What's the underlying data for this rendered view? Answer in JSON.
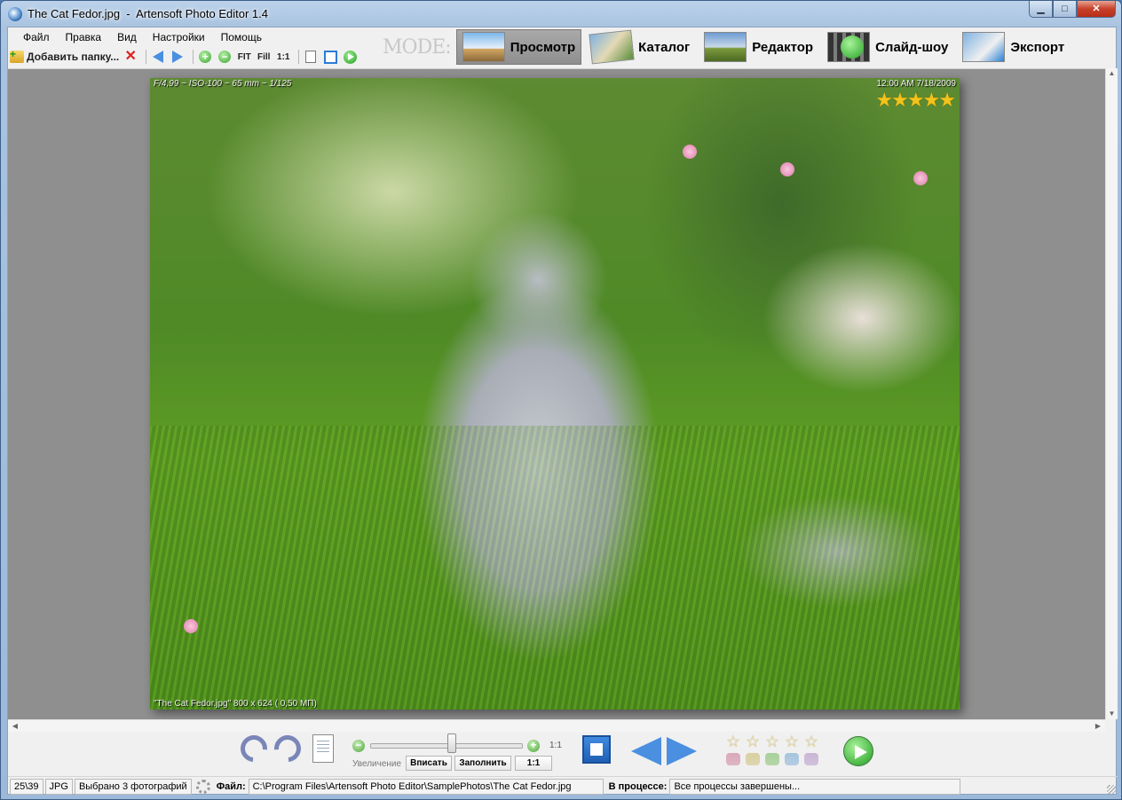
{
  "window": {
    "file_name": "The Cat Fedor.jpg",
    "app_name": "Artensoft Photo Editor 1.4",
    "buttons": {
      "minimize": "▁",
      "maximize": "□",
      "close": "✕"
    }
  },
  "menubar": {
    "items": [
      "Файл",
      "Правка",
      "Вид",
      "Настройки",
      "Помощь"
    ]
  },
  "toolbar": {
    "add_folder_label": "Добавить папку...",
    "fit_label": "FIT",
    "fill_label": "Fill",
    "one_to_one_label": "1:1"
  },
  "modebar": {
    "label": "MODE:",
    "tabs": [
      {
        "label": "Просмотр",
        "icon": "view-mode-icon",
        "active": true
      },
      {
        "label": "Каталог",
        "icon": "catalog-mode-icon",
        "active": false
      },
      {
        "label": "Редактор",
        "icon": "editor-mode-icon",
        "active": false
      },
      {
        "label": "Слайд-шоу",
        "icon": "slideshow-mode-icon",
        "active": false
      },
      {
        "label": "Экспорт",
        "icon": "export-mode-icon",
        "active": false
      }
    ]
  },
  "photo": {
    "exif": "F/4,99 ~ ISO-100 ~ 65 mm ~ 1/125",
    "datetime": "12:00 AM 7/18/2009",
    "rating_stars": "★★★★★",
    "rating": 5,
    "caption": "\"The Cat Fedor.jpg\"  800 x 624 ( 0,50 МП)"
  },
  "controls": {
    "zoom_label": "Увеличение",
    "zoom_fraction": 0.54,
    "zoom_ratio_label": "1:1",
    "fit_button": "Вписать",
    "fill_button": "Заполнить",
    "one_to_one_button": "1:1",
    "rating_stars": [
      "☆",
      "☆",
      "☆",
      "☆",
      "☆"
    ],
    "color_labels": [
      "#d9a8b8",
      "#d9cfa0",
      "#a8d098",
      "#a6c4de",
      "#c9b6d6"
    ]
  },
  "statusbar": {
    "position": "25\\39",
    "format": "JPG",
    "selected": "Выбрано 3 фотографий",
    "file_label": "Файл:",
    "file_path": "C:\\Program Files\\Artensoft Photo Editor\\SamplePhotos\\The Cat Fedor.jpg",
    "process_label": "В процессе:",
    "process_status": "Все процессы завершены..."
  }
}
